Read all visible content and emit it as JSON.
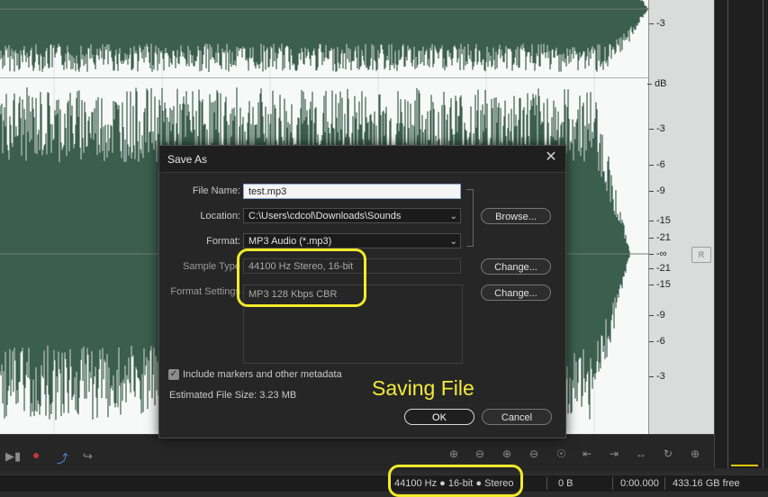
{
  "dialog": {
    "title": "Save As",
    "file_name_label": "File Name:",
    "file_name_value": "test.mp3",
    "location_label": "Location:",
    "location_value": "C:\\Users\\cdcol\\Downloads\\Sounds",
    "format_label": "Format:",
    "format_value": "MP3 Audio (*.mp3)",
    "sample_type_label": "Sample Type",
    "sample_type_value": "44100 Hz Stereo, 16-bit",
    "format_settings_label": "Format Settings",
    "format_settings_value": "MP3 128 Kbps CBR",
    "browse_label": "Browse...",
    "change_label": "Change...",
    "include_markers_label": "Include markers and other metadata",
    "include_markers_checked": true,
    "estimated_size": "Estimated File Size: 3.23 MB",
    "ok_label": "OK",
    "cancel_label": "Cancel",
    "close_icon": "close-icon"
  },
  "annotation": {
    "text": "Saving File",
    "color": "#f2ea2c"
  },
  "ruler": {
    "unit": "dB",
    "upper_ticks": [
      "-3"
    ],
    "lower_ticks": [
      "-3",
      "-6",
      "-9",
      "-15",
      "-21",
      "-∞",
      "-21",
      "-15",
      "-9",
      "-6",
      "-3"
    ],
    "channel_badge": "R"
  },
  "status": {
    "format": "44100 Hz ● 16-bit ● Stereo",
    "size": "0 B",
    "duration": "0:00.000",
    "free": "433.16 GB free"
  },
  "transport": {
    "icons": [
      "skip-to-end-icon",
      "record-icon",
      "loop-playback-icon",
      "skip-selection-icon"
    ],
    "zoom_icons": [
      "zoom-in-amplitude-icon",
      "zoom-out-amplitude-icon",
      "zoom-in-time-icon",
      "zoom-out-time-icon",
      "zoom-full-icon",
      "zoom-in-left-icon",
      "zoom-in-right-icon",
      "zoom-selection-icon",
      "zoom-reset-icon",
      "zoom-all-tracks-icon"
    ]
  },
  "colors": {
    "waveform": "#3b5e4f",
    "editor_bg": "#f7f9f8",
    "dialog_bg": "#262626",
    "highlight": "#f2ea2c"
  }
}
